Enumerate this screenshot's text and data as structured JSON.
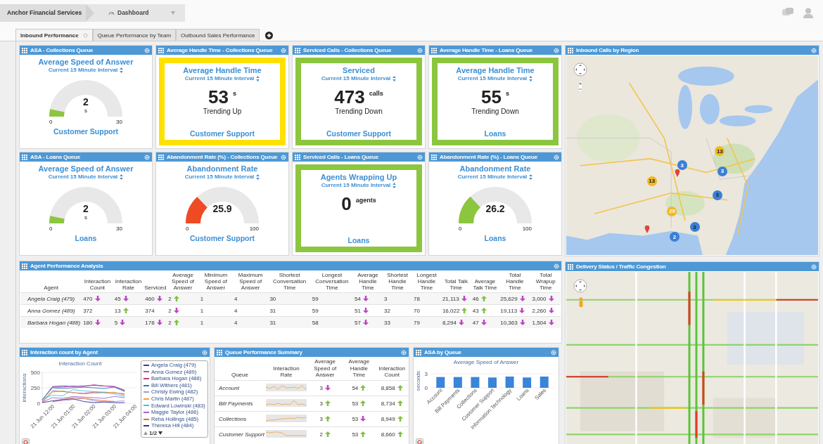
{
  "top_bar": {
    "breadcrumb": "Anchor Financial Services",
    "dashboard": "Dashboard"
  },
  "tabs": [
    {
      "label": "Inbound Performance",
      "selected": true
    },
    {
      "label": "Queue Performance by Team",
      "selected": false
    },
    {
      "label": "Outbound Sales Performance",
      "selected": false
    }
  ],
  "tiles": [
    {
      "kind": "gauge",
      "header": "ASA - Collections Queue",
      "title": "Average Speed of Answer",
      "interval": "Current 15 Minute Interval",
      "value": "2",
      "unit": "s",
      "min": "0",
      "max": "30",
      "color": "#8cc63f",
      "footer": "Customer Support"
    },
    {
      "kind": "metric",
      "header": "Average Handle Time - Collections Queue",
      "title": "Average Handle Time",
      "interval": "Current 15 Minute Interval",
      "value": "53",
      "unit": "s",
      "trend": "Trending Up",
      "color": "#ffe100",
      "footer": "Customer Support"
    },
    {
      "kind": "metric",
      "header": "Serviced Calls - Collections Queue",
      "title": "Serviced",
      "interval": "Current 15 Minute Interval",
      "value": "473",
      "unit": "calls",
      "trend": "Trending Down",
      "color": "#8cc63f",
      "footer": "Customer Support"
    },
    {
      "kind": "metric",
      "header": "Average Handle Time - Loans Queue",
      "title": "Average Handle Time",
      "interval": "Current 15 Minute Interval",
      "value": "55",
      "unit": "s",
      "trend": "Trending Down",
      "color": "#8cc63f",
      "footer": "Loans"
    },
    {
      "kind": "gauge",
      "header": "ASA - Loans Queue",
      "title": "Average Speed of Answer",
      "interval": "Current 15 Minute Interval",
      "value": "2",
      "unit": "s",
      "min": "0",
      "max": "30",
      "color": "#8cc63f",
      "footer": "Loans"
    },
    {
      "kind": "gauge",
      "header": "Abandonment Rate (%) - Collections Queue",
      "title": "Abandonment Rate",
      "interval": "Current 15 Minute Interval",
      "value": "25.9",
      "min": "0",
      "max": "100",
      "color": "#ee4a24",
      "footer": "Customer Support"
    },
    {
      "kind": "metric",
      "header": "Serviced Calls - Loans Queue",
      "title": "Agents Wrapping Up",
      "interval": "Current 15 Minute Interval",
      "value": "0",
      "unit": "agents",
      "color": "#8cc63f",
      "footer": "Loans"
    },
    {
      "kind": "gauge",
      "header": "Abandonment Rate (%) - Loans Queue",
      "title": "Abandonment Rate",
      "interval": "Current 15 Minute Interval",
      "value": "26.2",
      "min": "0",
      "max": "100",
      "color": "#8cc63f",
      "footer": "Loans"
    }
  ],
  "agent_panel": {
    "title": "Agent Performance Analysis",
    "columns": [
      "Agent",
      "Interaction Count",
      "Interaction Rate",
      "Serviced",
      "Average Speed of Answer",
      "Minimum Speed of Answer",
      "Maximum Speed of Answer",
      "Shortest Conversation Time",
      "Longest Conversation Time",
      "Average Handle Time",
      "Shortest Handle Time",
      "Longest Handle Time",
      "Total Talk Time",
      "Average Talk Time",
      "Total Handle Time",
      "Total Wrapup Time"
    ],
    "rows": [
      {
        "cells": [
          {
            "text": "Angela Craig (479)",
            "kind": "name"
          },
          {
            "text": "470",
            "kind": "down"
          },
          {
            "text": "45",
            "kind": "down"
          },
          {
            "text": "460",
            "kind": "down"
          },
          {
            "text": "2",
            "kind": "up"
          },
          {
            "text": "1",
            "kind": "plain"
          },
          {
            "text": "4",
            "kind": "plain"
          },
          {
            "text": "30",
            "kind": "plain"
          },
          {
            "text": "59",
            "kind": "plain"
          },
          {
            "text": "54",
            "kind": "down"
          },
          {
            "text": "3",
            "kind": "plain"
          },
          {
            "text": "78",
            "kind": "plain"
          },
          {
            "text": "21,113",
            "kind": "down"
          },
          {
            "text": "46",
            "kind": "up"
          },
          {
            "text": "25,629",
            "kind": "down"
          },
          {
            "text": "3,000",
            "kind": "down"
          }
        ]
      },
      {
        "cells": [
          {
            "text": "Anna Gomez (489)",
            "kind": "name"
          },
          {
            "text": "372",
            "kind": "plain"
          },
          {
            "text": "13",
            "kind": "up"
          },
          {
            "text": "374",
            "kind": "plain"
          },
          {
            "text": "2",
            "kind": "down"
          },
          {
            "text": "1",
            "kind": "plain"
          },
          {
            "text": "4",
            "kind": "plain"
          },
          {
            "text": "31",
            "kind": "plain"
          },
          {
            "text": "59",
            "kind": "plain"
          },
          {
            "text": "51",
            "kind": "down"
          },
          {
            "text": "32",
            "kind": "plain"
          },
          {
            "text": "70",
            "kind": "plain"
          },
          {
            "text": "16,022",
            "kind": "up"
          },
          {
            "text": "43",
            "kind": "up"
          },
          {
            "text": "19,113",
            "kind": "down"
          },
          {
            "text": "2,260",
            "kind": "down"
          }
        ]
      },
      {
        "cells": [
          {
            "text": "Barbara Hogan (488)",
            "kind": "name"
          },
          {
            "text": "180",
            "kind": "down"
          },
          {
            "text": "5",
            "kind": "down"
          },
          {
            "text": "178",
            "kind": "down"
          },
          {
            "text": "2",
            "kind": "up"
          },
          {
            "text": "1",
            "kind": "plain"
          },
          {
            "text": "4",
            "kind": "plain"
          },
          {
            "text": "31",
            "kind": "plain"
          },
          {
            "text": "58",
            "kind": "plain"
          },
          {
            "text": "57",
            "kind": "down"
          },
          {
            "text": "33",
            "kind": "plain"
          },
          {
            "text": "79",
            "kind": "plain"
          },
          {
            "text": "8,294",
            "kind": "down"
          },
          {
            "text": "47",
            "kind": "down"
          },
          {
            "text": "10,363",
            "kind": "down"
          },
          {
            "text": "1,504",
            "kind": "down"
          }
        ]
      }
    ]
  },
  "interaction_panel": {
    "title": "Interaction count by Agent",
    "pager": "1/2",
    "chart_data": {
      "type": "line",
      "title": "Interaction Count",
      "ylabel": "interactions",
      "categories": [
        null,
        "21 Jun 12:00",
        null,
        "21 Jun 01:00",
        null,
        "21 Jun 02:00",
        null,
        "21 Jun 03:00",
        null,
        "21 Jun 04:00"
      ],
      "ylim": [
        0,
        500
      ],
      "yticks": [
        0,
        250,
        500
      ],
      "series": [
        {
          "name": "Angela Craig (479)",
          "color": "#3b3b9b",
          "values": [
            50,
            270,
            280,
            270,
            280,
            290,
            280,
            270,
            210,
            null
          ]
        },
        {
          "name": "Anna Gomez (489)",
          "color": "#cc44aa",
          "values": [
            null,
            260,
            260,
            280,
            270,
            300,
            280,
            270,
            200,
            null
          ]
        },
        {
          "name": "Barbara Hogan (488)",
          "color": "#aa4477",
          "values": [
            30,
            200,
            190,
            170,
            160,
            180,
            180,
            170,
            150,
            null
          ]
        },
        {
          "name": "Bill Withers (481)",
          "color": "#2e78b5",
          "values": [
            60,
            250,
            240,
            250,
            260,
            250,
            240,
            260,
            190,
            null
          ]
        },
        {
          "name": "Christy Ewing (482)",
          "color": "#9b9bd6",
          "values": [
            null,
            30,
            40,
            60,
            80,
            40,
            20,
            30,
            40,
            null
          ]
        },
        {
          "name": "Chris Martin (487)",
          "color": "#f5a032",
          "values": [
            10,
            180,
            200,
            170,
            150,
            160,
            170,
            180,
            130,
            null
          ]
        },
        {
          "name": "Edward Lowinski (483)",
          "color": "#40c0f0",
          "values": [
            70,
            130,
            120,
            220,
            200,
            190,
            170,
            150,
            110,
            null
          ]
        },
        {
          "name": "Maggie Taylor (486)",
          "color": "#9966cc",
          "values": [
            20,
            90,
            80,
            110,
            100,
            90,
            80,
            110,
            90,
            null
          ]
        },
        {
          "name": "Reba Hollings (485)",
          "color": "#f06a30",
          "values": [
            null,
            20,
            60,
            90,
            80,
            60,
            40,
            30,
            null,
            null
          ]
        },
        {
          "name": "Theresa Hill (484)",
          "color": "#3030a0",
          "values": [
            10,
            40,
            60,
            70,
            30,
            10,
            20,
            10,
            10,
            null
          ]
        }
      ]
    }
  },
  "queue_panel": {
    "title": "Queue Performance Summary",
    "columns": [
      "Queue",
      "Interaction Rate",
      "Average Speed of Answer",
      "Average Handle Time",
      "Interaction Count"
    ],
    "rows": [
      {
        "cells": [
          {
            "text": "Account",
            "kind": "name"
          },
          {
            "kind": "sparkline"
          },
          {
            "text": "3",
            "kind": "down"
          },
          {
            "text": "54",
            "kind": "up"
          },
          {
            "text": "8,858",
            "kind": "up"
          }
        ]
      },
      {
        "cells": [
          {
            "text": "Bill Payments",
            "kind": "name"
          },
          {
            "kind": "sparkline"
          },
          {
            "text": "3",
            "kind": "up"
          },
          {
            "text": "53",
            "kind": "up"
          },
          {
            "text": "8,734",
            "kind": "up"
          }
        ]
      },
      {
        "cells": [
          {
            "text": "Collections",
            "kind": "name"
          },
          {
            "kind": "sparkline"
          },
          {
            "text": "3",
            "kind": "up"
          },
          {
            "text": "53",
            "kind": "down"
          },
          {
            "text": "8,949",
            "kind": "up"
          }
        ]
      },
      {
        "cells": [
          {
            "text": "Customer Support",
            "kind": "name"
          },
          {
            "kind": "sparkline"
          },
          {
            "text": "2",
            "kind": "up"
          },
          {
            "text": "53",
            "kind": "up"
          },
          {
            "text": "8,660",
            "kind": "up"
          }
        ]
      }
    ]
  },
  "asa_panel": {
    "title": "ASA by Queue",
    "chart_data": {
      "type": "bar",
      "title": "Average Speed of Answer",
      "ylabel": "seconds",
      "categories": [
        "Account",
        "Bill Payments",
        "Collections",
        "Customer Support",
        "Information Technology",
        "Loans",
        "Sales"
      ],
      "values": [
        2.3,
        2.3,
        2.3,
        2.2,
        2.4,
        2.2,
        2.4
      ],
      "ylim": [
        0,
        3
      ],
      "yticks": [
        0,
        3
      ]
    }
  },
  "inbound_map": {
    "title": "Inbound Calls by Region",
    "clusters": [
      {
        "count": "13",
        "color": "#f2b820"
      },
      {
        "count": "3",
        "color": "#3a7fd5"
      },
      {
        "count": "13",
        "color": "#f2b820"
      },
      {
        "count": "3",
        "color": "#3a7fd5"
      },
      {
        "count": "3",
        "color": "#3a7fd5"
      },
      {
        "count": "29",
        "color": "#f2b820"
      },
      {
        "count": "3",
        "color": "#3a7fd5"
      },
      {
        "count": "2",
        "color": "#3a7fd5"
      }
    ]
  },
  "traffic_map": {
    "title": "Delivery Status / Traffic Congestion"
  }
}
